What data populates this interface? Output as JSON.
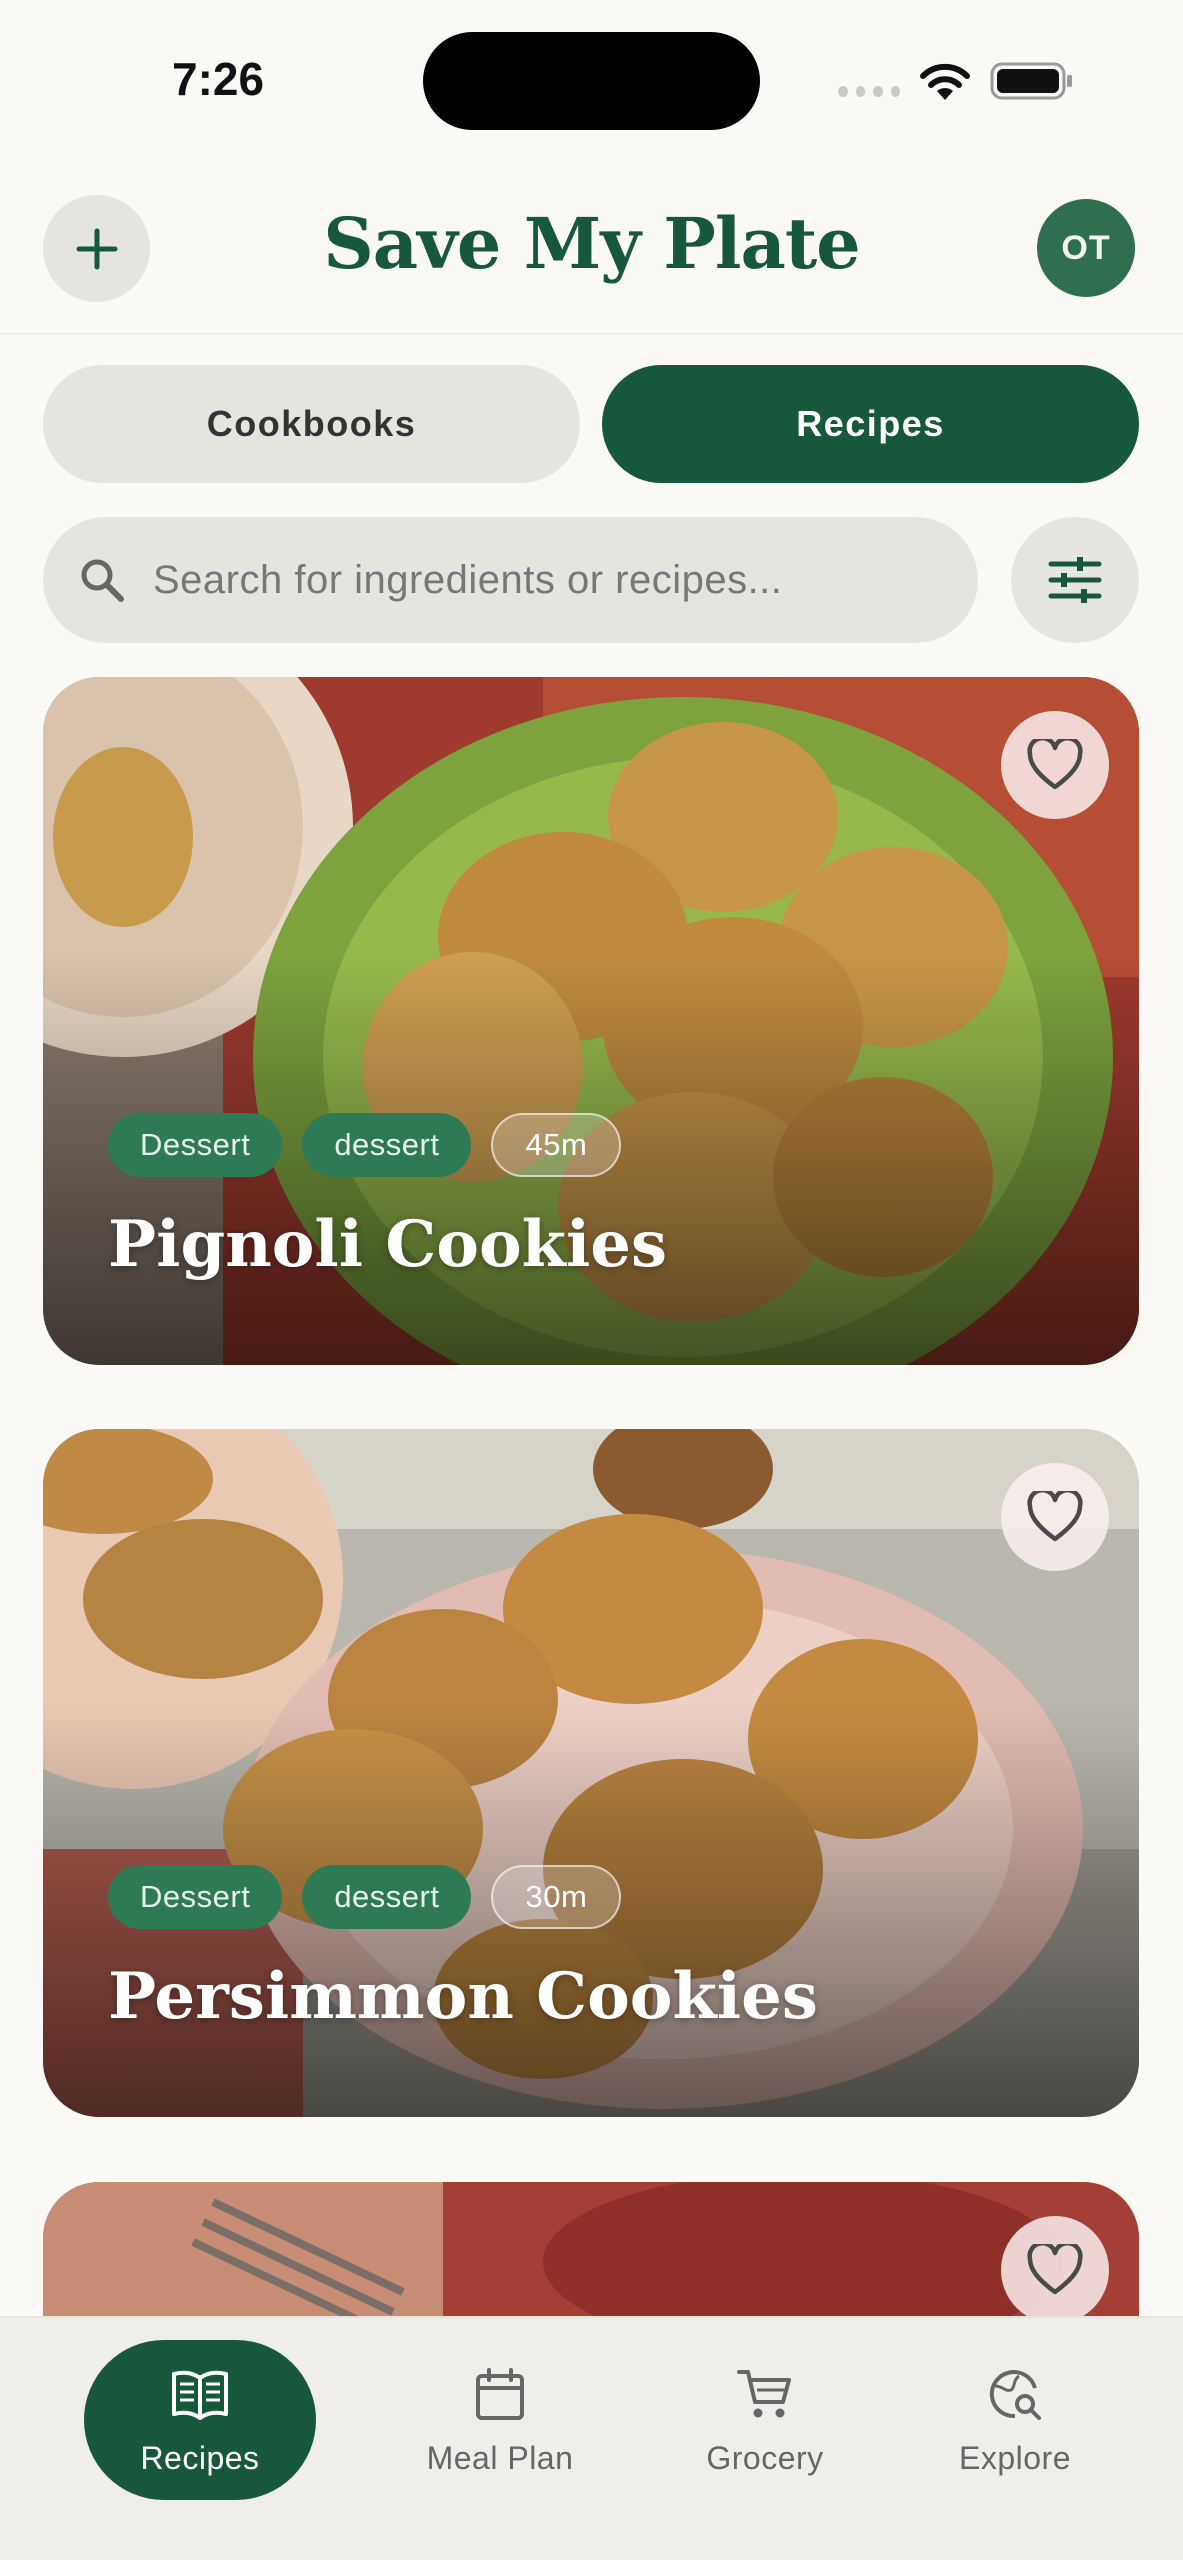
{
  "status_bar": {
    "time": "7:26"
  },
  "header": {
    "title": "Save My Plate",
    "avatar_initials": "OT",
    "add_icon": "plus-icon"
  },
  "segments": {
    "cookbooks": "Cookbooks",
    "recipes": "Recipes",
    "selected": "Recipes"
  },
  "search": {
    "placeholder": "Search for ingredients or recipes..."
  },
  "recipes": [
    {
      "title": "Pignoli Cookies",
      "tags": [
        "Dessert",
        "dessert"
      ],
      "time": "45m",
      "favorited": false
    },
    {
      "title": "Persimmon Cookies",
      "tags": [
        "Dessert",
        "dessert"
      ],
      "time": "30m",
      "favorited": false
    },
    {
      "title": "",
      "tags": [],
      "time": "",
      "favorited": false
    }
  ],
  "bottom_nav": [
    {
      "label": "Recipes",
      "icon": "book-icon",
      "active": true
    },
    {
      "label": "Meal Plan",
      "icon": "calendar-icon",
      "active": false
    },
    {
      "label": "Grocery",
      "icon": "cart-icon",
      "active": false
    },
    {
      "label": "Explore",
      "icon": "globe-search-icon",
      "active": false
    }
  ],
  "colors": {
    "brand_green": "#17573c",
    "tag_green": "#2e7a55",
    "chip_grey": "#e6e4df",
    "background": "#fbf9f5"
  }
}
